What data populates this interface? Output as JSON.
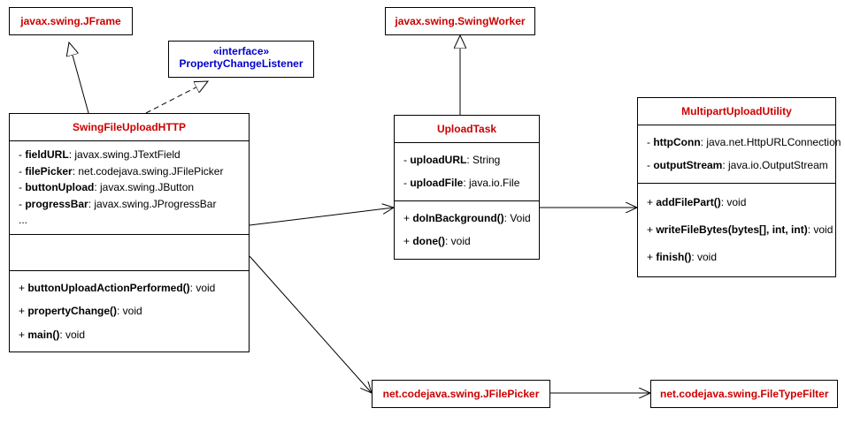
{
  "classes": {
    "jframe": {
      "name": "javax.swing.JFrame"
    },
    "pcl": {
      "stereotype": "«interface»",
      "name": "PropertyChangeListener"
    },
    "swingworker": {
      "name": "javax.swing.SwingWorker"
    },
    "swingfileupload": {
      "name": "SwingFileUploadHTTP",
      "fields": {
        "f1": {
          "vis": "- ",
          "name": "fieldURL",
          "type": ": javax.swing.JTextField"
        },
        "f2": {
          "vis": "- ",
          "name": "filePicker",
          "type": ": net.codejava.swing.JFilePicker"
        },
        "f3": {
          "vis": "- ",
          "name": "buttonUpload",
          "type": ": javax.swing.JButton"
        },
        "f4": {
          "vis": "- ",
          "name": "progressBar",
          "type": ": javax.swing.JProgressBar"
        },
        "more": "..."
      },
      "methods": {
        "m1": {
          "vis": "+ ",
          "name": "buttonUploadActionPerformed()",
          "ret": ": void"
        },
        "m2": {
          "vis": "+ ",
          "name": "propertyChange()",
          "ret": ": void"
        },
        "m3": {
          "vis": "+ ",
          "name": "main()",
          "ret": ": void"
        }
      }
    },
    "uploadtask": {
      "name": "UploadTask",
      "fields": {
        "f1": {
          "vis": "- ",
          "name": "uploadURL",
          "type": ": String"
        },
        "f2": {
          "vis": "- ",
          "name": "uploadFile",
          "type": ": java.io.File"
        }
      },
      "methods": {
        "m1": {
          "vis": "+ ",
          "name": "doInBackground()",
          "ret": ": Void"
        },
        "m2": {
          "vis": "+ ",
          "name": "done()",
          "ret": ": void"
        }
      }
    },
    "multipart": {
      "name": "MultipartUploadUtility",
      "fields": {
        "f1": {
          "vis": "- ",
          "name": "httpConn",
          "type": ": java.net.HttpURLConnection"
        },
        "f2": {
          "vis": "- ",
          "name": "outputStream",
          "type": ": java.io.OutputStream"
        }
      },
      "methods": {
        "m1": {
          "vis": "+ ",
          "name": "addFilePart()",
          "ret": ": void"
        },
        "m2": {
          "vis": "+ ",
          "name": "writeFileBytes(bytes[], int, int)",
          "ret": ": void"
        },
        "m3": {
          "vis": "+ ",
          "name": "finish()",
          "ret": ": void"
        }
      }
    },
    "jfilepicker": {
      "name": "net.codejava.swing.JFilePicker"
    },
    "filetypefilter": {
      "name": "net.codejava.swing.FileTypeFilter"
    }
  }
}
